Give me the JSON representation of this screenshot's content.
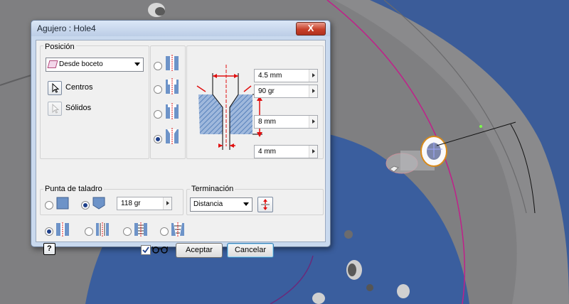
{
  "colors": {
    "accent_red": "#e01010",
    "hatch_blue": "#3f6fb0",
    "axis_magenta": "#c0208a"
  },
  "dialog": {
    "title": "Agujero : Hole4",
    "close_label": "X",
    "posicion": {
      "label": "Posición",
      "dropdown_value": "Desde boceto",
      "centros_label": "Centros",
      "solidos_label": "Sólidos"
    },
    "dimensions": {
      "d1": "4.5 mm",
      "angle": "90 gr",
      "depth": "8 mm",
      "d2": "4 mm"
    },
    "punta": {
      "label": "Punta de taladro",
      "angle_value": "118 gr"
    },
    "terminacion": {
      "label": "Terminación",
      "dropdown_value": "Distancia"
    },
    "buttons": {
      "accept": "Aceptar",
      "cancel": "Cancelar",
      "help": "?"
    },
    "preview_checked": true
  }
}
